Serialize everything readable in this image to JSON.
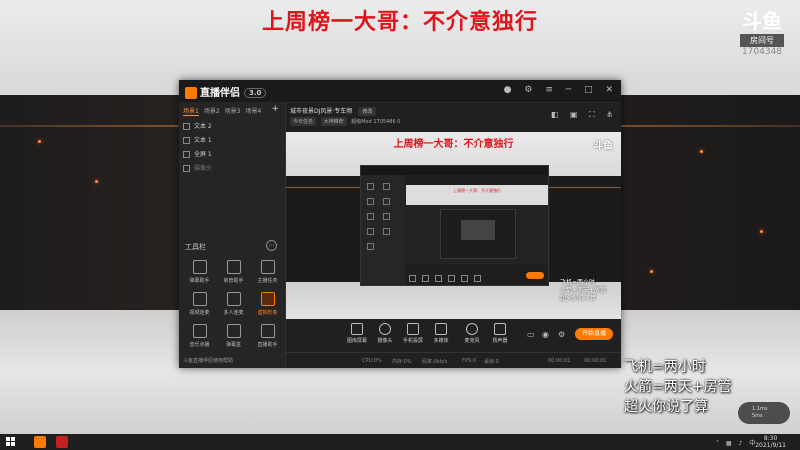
{
  "stream": {
    "title": "上周榜一大哥：不介意独行",
    "logo": "斗鱼",
    "room_label": "房间号",
    "room_number": "1704348"
  },
  "app": {
    "name": "直播伴侣",
    "version": "3.0",
    "scene_tabs": [
      "场景1",
      "场景2",
      "场景3",
      "场景4"
    ],
    "sources": [
      "文本 2",
      "文本 1",
      "全屏 1",
      "摄像头"
    ],
    "tools_title": "工具栏",
    "tools": [
      "弹幕助手",
      "房管助手",
      "主播任务",
      "视频连麦",
      "多人连麦",
      "虚拟形象",
      "音乐点播",
      "弹幕盒",
      "直播助手",
      "截图",
      "更多",
      "设置"
    ],
    "footer_tip": "斗鱼直播伴侣使用帮助",
    "room_title": "城市夜景DJ风景·专车频",
    "edit_label": "修改",
    "chips": [
      "今日任务",
      "大神推荐",
      "超级Mod",
      "1705486",
      "0"
    ],
    "controls": [
      "图库屏幕",
      "摄像头",
      "手机投屏",
      "多媒体",
      "麦克风",
      "扬声器"
    ],
    "start_button": "开始直播",
    "status": {
      "cpu": "CPU:0%",
      "mem": "内存:0%",
      "bitrate": "码率:0kb/s",
      "fps": "FPS:0",
      "drop": "丢帧:0",
      "time1": "00:00:01",
      "time2": "00:00:01"
    }
  },
  "chat": {
    "lines": [
      "飞机=两小时",
      "火箭=两天+房管",
      "超火你说了算"
    ],
    "gift": [
      "1.1ms",
      "5ms"
    ]
  },
  "taskbar": {
    "time": "8:30",
    "date": "2021/9/11"
  }
}
